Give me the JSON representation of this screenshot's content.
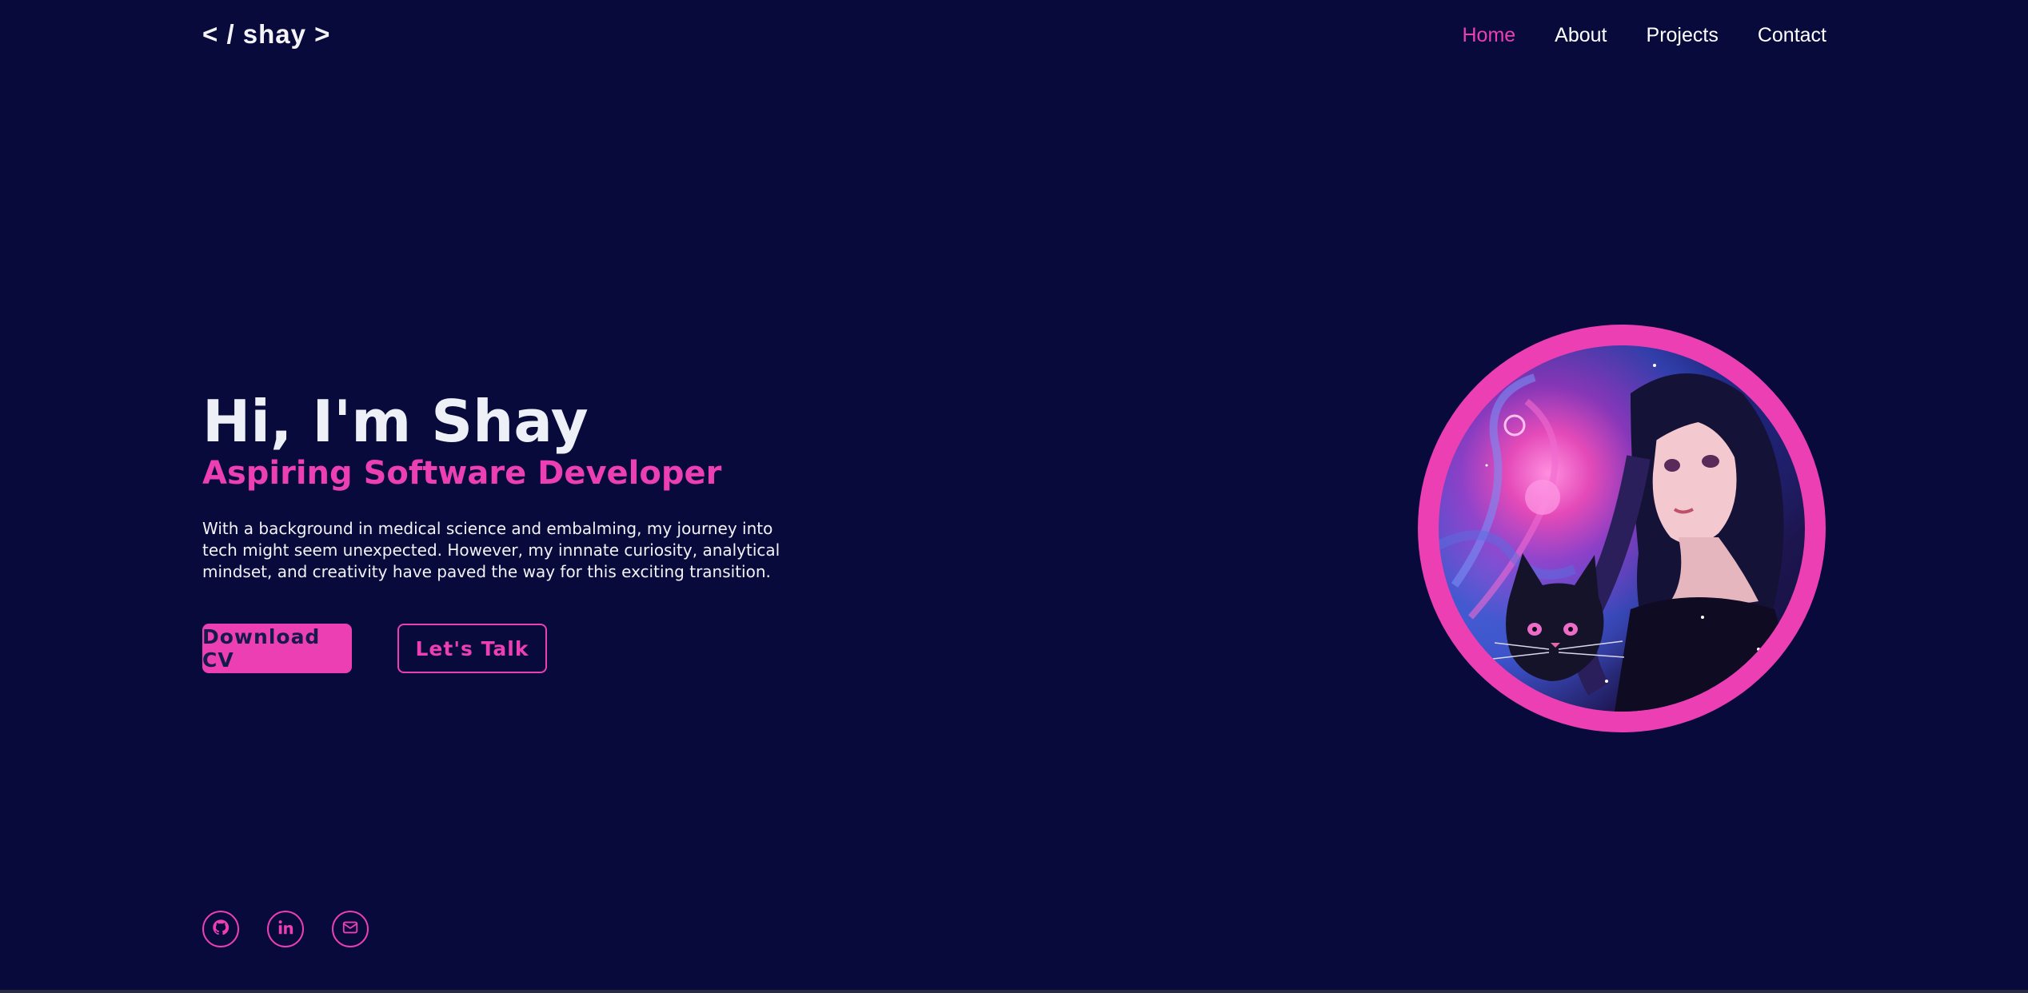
{
  "header": {
    "logo": "< / shay >",
    "nav": [
      {
        "label": "Home",
        "active": true
      },
      {
        "label": "About",
        "active": false
      },
      {
        "label": "Projects",
        "active": false
      },
      {
        "label": "Contact",
        "active": false
      }
    ]
  },
  "hero": {
    "title": "Hi, I'm Shay",
    "subtitle": "Aspiring Software Developer",
    "description": "With a background in medical science and embalming, my journey into tech might seem unexpected. However, my innnate curiosity, analytical mindset, and creativity have paved the way for this exciting transition.",
    "buttons": {
      "download": "Download CV",
      "talk": "Let's Talk"
    }
  },
  "profile_image": {
    "icon": "portrait-illustration-icon"
  },
  "socials": [
    {
      "icon": "github-icon"
    },
    {
      "icon": "linkedin-icon"
    },
    {
      "icon": "mail-icon"
    }
  ],
  "colors": {
    "background": "#080a3c",
    "accent": "#ec3fb4",
    "text": "#f2f2f7"
  }
}
